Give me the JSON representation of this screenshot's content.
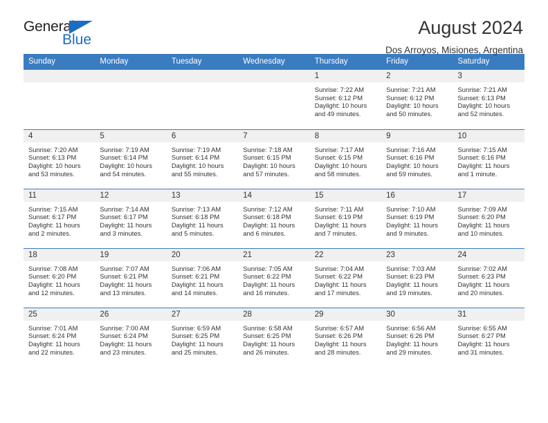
{
  "logo": {
    "primary_text": "General",
    "secondary_text": "Blue",
    "accent_color": "#1b6ec2",
    "triangle_icon": "logo-triangle-icon"
  },
  "header": {
    "title": "August 2024",
    "subtitle": "Dos Arroyos, Misiones, Argentina"
  },
  "theme": {
    "header_bg": "#3a7cc0",
    "header_text": "#ffffff",
    "daynum_bg": "#f0f0f0",
    "text": "#333333"
  },
  "weekday_headers": [
    "Sunday",
    "Monday",
    "Tuesday",
    "Wednesday",
    "Thursday",
    "Friday",
    "Saturday"
  ],
  "weeks": [
    [
      {
        "day": "",
        "blank": true,
        "sunrise": "",
        "sunset": "",
        "daylight_line1": "",
        "daylight_line2": ""
      },
      {
        "day": "",
        "blank": true,
        "sunrise": "",
        "sunset": "",
        "daylight_line1": "",
        "daylight_line2": ""
      },
      {
        "day": "",
        "blank": true,
        "sunrise": "",
        "sunset": "",
        "daylight_line1": "",
        "daylight_line2": ""
      },
      {
        "day": "",
        "blank": true,
        "sunrise": "",
        "sunset": "",
        "daylight_line1": "",
        "daylight_line2": ""
      },
      {
        "day": "1",
        "blank": false,
        "sunrise": "Sunrise: 7:22 AM",
        "sunset": "Sunset: 6:12 PM",
        "daylight_line1": "Daylight: 10 hours",
        "daylight_line2": "and 49 minutes."
      },
      {
        "day": "2",
        "blank": false,
        "sunrise": "Sunrise: 7:21 AM",
        "sunset": "Sunset: 6:12 PM",
        "daylight_line1": "Daylight: 10 hours",
        "daylight_line2": "and 50 minutes."
      },
      {
        "day": "3",
        "blank": false,
        "sunrise": "Sunrise: 7:21 AM",
        "sunset": "Sunset: 6:13 PM",
        "daylight_line1": "Daylight: 10 hours",
        "daylight_line2": "and 52 minutes."
      }
    ],
    [
      {
        "day": "4",
        "blank": false,
        "sunrise": "Sunrise: 7:20 AM",
        "sunset": "Sunset: 6:13 PM",
        "daylight_line1": "Daylight: 10 hours",
        "daylight_line2": "and 53 minutes."
      },
      {
        "day": "5",
        "blank": false,
        "sunrise": "Sunrise: 7:19 AM",
        "sunset": "Sunset: 6:14 PM",
        "daylight_line1": "Daylight: 10 hours",
        "daylight_line2": "and 54 minutes."
      },
      {
        "day": "6",
        "blank": false,
        "sunrise": "Sunrise: 7:19 AM",
        "sunset": "Sunset: 6:14 PM",
        "daylight_line1": "Daylight: 10 hours",
        "daylight_line2": "and 55 minutes."
      },
      {
        "day": "7",
        "blank": false,
        "sunrise": "Sunrise: 7:18 AM",
        "sunset": "Sunset: 6:15 PM",
        "daylight_line1": "Daylight: 10 hours",
        "daylight_line2": "and 57 minutes."
      },
      {
        "day": "8",
        "blank": false,
        "sunrise": "Sunrise: 7:17 AM",
        "sunset": "Sunset: 6:15 PM",
        "daylight_line1": "Daylight: 10 hours",
        "daylight_line2": "and 58 minutes."
      },
      {
        "day": "9",
        "blank": false,
        "sunrise": "Sunrise: 7:16 AM",
        "sunset": "Sunset: 6:16 PM",
        "daylight_line1": "Daylight: 10 hours",
        "daylight_line2": "and 59 minutes."
      },
      {
        "day": "10",
        "blank": false,
        "sunrise": "Sunrise: 7:15 AM",
        "sunset": "Sunset: 6:16 PM",
        "daylight_line1": "Daylight: 11 hours",
        "daylight_line2": "and 1 minute."
      }
    ],
    [
      {
        "day": "11",
        "blank": false,
        "sunrise": "Sunrise: 7:15 AM",
        "sunset": "Sunset: 6:17 PM",
        "daylight_line1": "Daylight: 11 hours",
        "daylight_line2": "and 2 minutes."
      },
      {
        "day": "12",
        "blank": false,
        "sunrise": "Sunrise: 7:14 AM",
        "sunset": "Sunset: 6:17 PM",
        "daylight_line1": "Daylight: 11 hours",
        "daylight_line2": "and 3 minutes."
      },
      {
        "day": "13",
        "blank": false,
        "sunrise": "Sunrise: 7:13 AM",
        "sunset": "Sunset: 6:18 PM",
        "daylight_line1": "Daylight: 11 hours",
        "daylight_line2": "and 5 minutes."
      },
      {
        "day": "14",
        "blank": false,
        "sunrise": "Sunrise: 7:12 AM",
        "sunset": "Sunset: 6:18 PM",
        "daylight_line1": "Daylight: 11 hours",
        "daylight_line2": "and 6 minutes."
      },
      {
        "day": "15",
        "blank": false,
        "sunrise": "Sunrise: 7:11 AM",
        "sunset": "Sunset: 6:19 PM",
        "daylight_line1": "Daylight: 11 hours",
        "daylight_line2": "and 7 minutes."
      },
      {
        "day": "16",
        "blank": false,
        "sunrise": "Sunrise: 7:10 AM",
        "sunset": "Sunset: 6:19 PM",
        "daylight_line1": "Daylight: 11 hours",
        "daylight_line2": "and 9 minutes."
      },
      {
        "day": "17",
        "blank": false,
        "sunrise": "Sunrise: 7:09 AM",
        "sunset": "Sunset: 6:20 PM",
        "daylight_line1": "Daylight: 11 hours",
        "daylight_line2": "and 10 minutes."
      }
    ],
    [
      {
        "day": "18",
        "blank": false,
        "sunrise": "Sunrise: 7:08 AM",
        "sunset": "Sunset: 6:20 PM",
        "daylight_line1": "Daylight: 11 hours",
        "daylight_line2": "and 12 minutes."
      },
      {
        "day": "19",
        "blank": false,
        "sunrise": "Sunrise: 7:07 AM",
        "sunset": "Sunset: 6:21 PM",
        "daylight_line1": "Daylight: 11 hours",
        "daylight_line2": "and 13 minutes."
      },
      {
        "day": "20",
        "blank": false,
        "sunrise": "Sunrise: 7:06 AM",
        "sunset": "Sunset: 6:21 PM",
        "daylight_line1": "Daylight: 11 hours",
        "daylight_line2": "and 14 minutes."
      },
      {
        "day": "21",
        "blank": false,
        "sunrise": "Sunrise: 7:05 AM",
        "sunset": "Sunset: 6:22 PM",
        "daylight_line1": "Daylight: 11 hours",
        "daylight_line2": "and 16 minutes."
      },
      {
        "day": "22",
        "blank": false,
        "sunrise": "Sunrise: 7:04 AM",
        "sunset": "Sunset: 6:22 PM",
        "daylight_line1": "Daylight: 11 hours",
        "daylight_line2": "and 17 minutes."
      },
      {
        "day": "23",
        "blank": false,
        "sunrise": "Sunrise: 7:03 AM",
        "sunset": "Sunset: 6:23 PM",
        "daylight_line1": "Daylight: 11 hours",
        "daylight_line2": "and 19 minutes."
      },
      {
        "day": "24",
        "blank": false,
        "sunrise": "Sunrise: 7:02 AM",
        "sunset": "Sunset: 6:23 PM",
        "daylight_line1": "Daylight: 11 hours",
        "daylight_line2": "and 20 minutes."
      }
    ],
    [
      {
        "day": "25",
        "blank": false,
        "sunrise": "Sunrise: 7:01 AM",
        "sunset": "Sunset: 6:24 PM",
        "daylight_line1": "Daylight: 11 hours",
        "daylight_line2": "and 22 minutes."
      },
      {
        "day": "26",
        "blank": false,
        "sunrise": "Sunrise: 7:00 AM",
        "sunset": "Sunset: 6:24 PM",
        "daylight_line1": "Daylight: 11 hours",
        "daylight_line2": "and 23 minutes."
      },
      {
        "day": "27",
        "blank": false,
        "sunrise": "Sunrise: 6:59 AM",
        "sunset": "Sunset: 6:25 PM",
        "daylight_line1": "Daylight: 11 hours",
        "daylight_line2": "and 25 minutes."
      },
      {
        "day": "28",
        "blank": false,
        "sunrise": "Sunrise: 6:58 AM",
        "sunset": "Sunset: 6:25 PM",
        "daylight_line1": "Daylight: 11 hours",
        "daylight_line2": "and 26 minutes."
      },
      {
        "day": "29",
        "blank": false,
        "sunrise": "Sunrise: 6:57 AM",
        "sunset": "Sunset: 6:26 PM",
        "daylight_line1": "Daylight: 11 hours",
        "daylight_line2": "and 28 minutes."
      },
      {
        "day": "30",
        "blank": false,
        "sunrise": "Sunrise: 6:56 AM",
        "sunset": "Sunset: 6:26 PM",
        "daylight_line1": "Daylight: 11 hours",
        "daylight_line2": "and 29 minutes."
      },
      {
        "day": "31",
        "blank": false,
        "sunrise": "Sunrise: 6:55 AM",
        "sunset": "Sunset: 6:27 PM",
        "daylight_line1": "Daylight: 11 hours",
        "daylight_line2": "and 31 minutes."
      }
    ]
  ]
}
